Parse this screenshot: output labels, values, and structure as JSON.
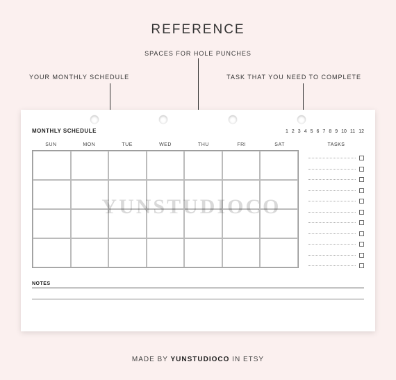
{
  "title": "REFERENCE",
  "annotations": {
    "left": "YOUR MONTHLY SCHEDULE",
    "mid": "SPACES FOR HOLE PUNCHES",
    "right": "TASK THAT YOU NEED TO COMPLETE"
  },
  "sheet": {
    "title": "MONTHLY SCHEDULE",
    "months": [
      "1",
      "2",
      "3",
      "4",
      "5",
      "6",
      "7",
      "8",
      "9",
      "10",
      "11",
      "12"
    ],
    "days": [
      "SUN",
      "MON",
      "TUE",
      "WED",
      "THU",
      "FRI",
      "SAT"
    ],
    "grid_rows": 4,
    "grid_cols": 7,
    "tasks_title": "TASKS",
    "task_count": 11,
    "notes_title": "NOTES",
    "note_lines": 1,
    "punch_count": 4
  },
  "watermark": "YUNSTUDIOCO",
  "footer": {
    "prefix": "MADE BY ",
    "brand": "YUNSTUDIOCO",
    "suffix": " IN ETSY"
  }
}
